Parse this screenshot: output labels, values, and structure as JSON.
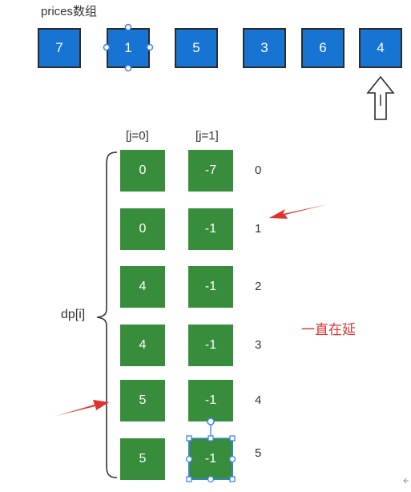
{
  "prices": {
    "label": "prices数组",
    "values": [
      "7",
      "1",
      "5",
      "3",
      "6",
      "4"
    ]
  },
  "dp": {
    "label": "dp[i]",
    "col_headers": [
      "[j=0]",
      "[j=1]"
    ],
    "rows": [
      {
        "j0": "0",
        "j1": "-7",
        "i": "0"
      },
      {
        "j0": "0",
        "j1": "-1",
        "i": "1"
      },
      {
        "j0": "4",
        "j1": "-1",
        "i": "2"
      },
      {
        "j0": "4",
        "j1": "-1",
        "i": "3"
      },
      {
        "j0": "5",
        "j1": "-1",
        "i": "4"
      },
      {
        "j0": "5",
        "j1": "-1",
        "i": "5"
      }
    ]
  },
  "annotation": "一直在延",
  "colors": {
    "price_box": "#1874d2",
    "dp_cell": "#378d3b",
    "arrow_red": "#e0322f",
    "selection": "#3b82f6"
  },
  "icons": [
    "up-arrow-icon",
    "red-arrow-icon",
    "brace-icon"
  ]
}
